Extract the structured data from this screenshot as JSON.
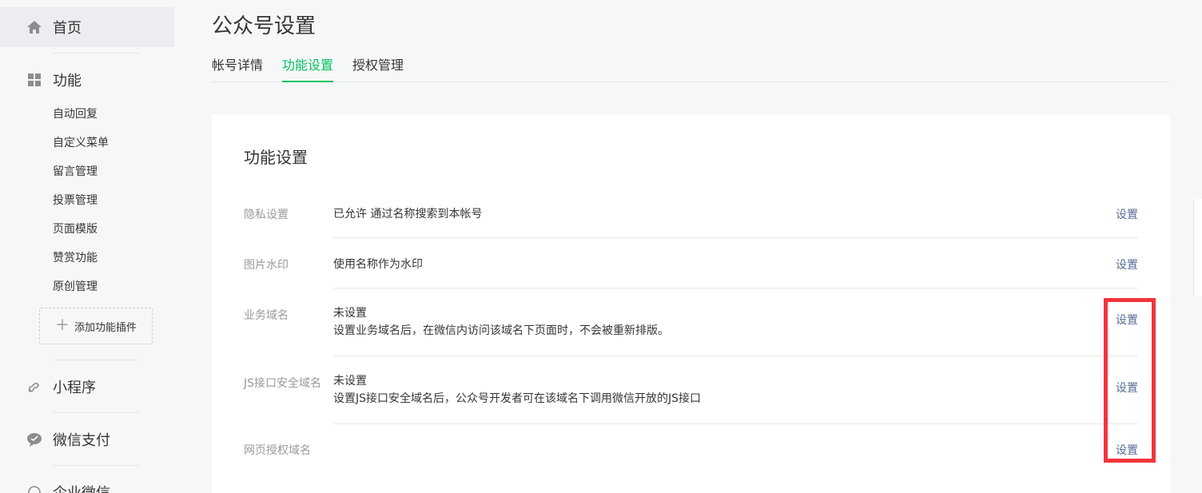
{
  "page_title": "公众号设置",
  "sidebar": {
    "home": "首页",
    "features": "功能",
    "feature_items": [
      "自动回复",
      "自定义菜单",
      "留言管理",
      "投票管理",
      "页面模版",
      "赞赏功能",
      "原创管理"
    ],
    "add_plugin": "添加功能插件",
    "mini_program": "小程序",
    "wechat_pay": "微信支付",
    "wecom": "企业微信"
  },
  "tabs": [
    "帐号详情",
    "功能设置",
    "授权管理"
  ],
  "active_tab": "功能设置",
  "card": {
    "title": "功能设置",
    "action_label": "设置",
    "rows": [
      {
        "label": "隐私设置",
        "lines": [
          "已允许 通过名称搜索到本帐号"
        ]
      },
      {
        "label": "图片水印",
        "lines": [
          "使用名称作为水印"
        ]
      },
      {
        "label": "业务域名",
        "lines": [
          "未设置",
          "设置业务域名后，在微信内访问该域名下页面时，不会被重新排版。"
        ]
      },
      {
        "label": "JS接口安全域名",
        "lines": [
          "未设置",
          "设置JS接口安全域名后，公众号开发者可在该域名下调用微信开放的JS接口"
        ]
      },
      {
        "label": "网页授权域名",
        "lines": []
      }
    ]
  },
  "colors": {
    "accent_green": "#07c160",
    "link_blue": "#576b95",
    "highlight_red": "#f2353b"
  }
}
